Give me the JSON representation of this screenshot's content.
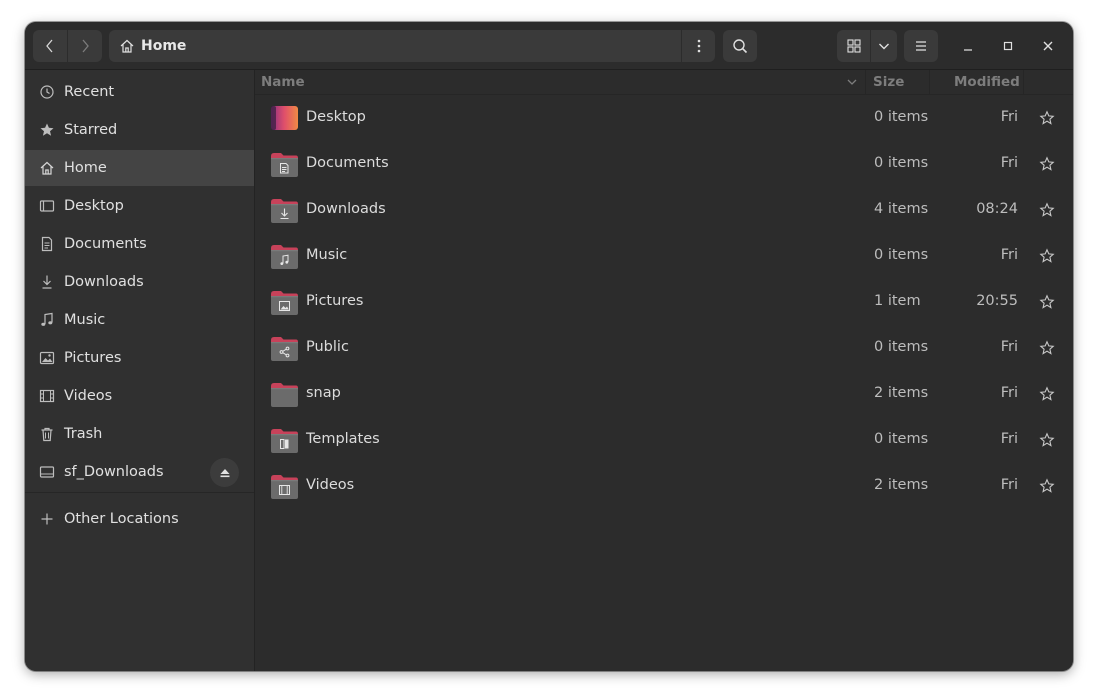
{
  "header": {
    "path_label": "Home",
    "icons": [
      "chevron-left-icon",
      "chevron-right-icon",
      "home-icon",
      "kebab-menu-icon",
      "search-icon",
      "grid-view-icon",
      "chevron-down-icon",
      "hamburger-menu-icon",
      "minimize-icon",
      "maximize-icon",
      "close-icon"
    ]
  },
  "sidebar": {
    "items": [
      {
        "label": "Recent",
        "icon": "clock-icon"
      },
      {
        "label": "Starred",
        "icon": "star-icon"
      },
      {
        "label": "Home",
        "icon": "home-icon",
        "active": true
      },
      {
        "label": "Desktop",
        "icon": "desktop-icon"
      },
      {
        "label": "Documents",
        "icon": "document-icon"
      },
      {
        "label": "Downloads",
        "icon": "download-icon"
      },
      {
        "label": "Music",
        "icon": "music-note-icon"
      },
      {
        "label": "Pictures",
        "icon": "image-icon"
      },
      {
        "label": "Videos",
        "icon": "film-icon"
      },
      {
        "label": "Trash",
        "icon": "trash-icon"
      },
      {
        "label": "sf_Downloads",
        "icon": "drive-icon",
        "eject": true
      }
    ],
    "other_locations": "Other Locations"
  },
  "columns": {
    "name": "Name",
    "size": "Size",
    "modified": "Modified"
  },
  "files": [
    {
      "name": "Desktop",
      "size": "0 items",
      "modified": "Fri",
      "icon": "desktop-folder-icon"
    },
    {
      "name": "Documents",
      "size": "0 items",
      "modified": "Fri",
      "icon": "documents-folder-icon"
    },
    {
      "name": "Downloads",
      "size": "4 items",
      "modified": "08:24",
      "icon": "downloads-folder-icon"
    },
    {
      "name": "Music",
      "size": "0 items",
      "modified": "Fri",
      "icon": "music-folder-icon"
    },
    {
      "name": "Pictures",
      "size": "1 item",
      "modified": "20:55",
      "icon": "pictures-folder-icon"
    },
    {
      "name": "Public",
      "size": "0 items",
      "modified": "Fri",
      "icon": "public-folder-icon"
    },
    {
      "name": "snap",
      "size": "2 items",
      "modified": "Fri",
      "icon": "folder-icon"
    },
    {
      "name": "Templates",
      "size": "0 items",
      "modified": "Fri",
      "icon": "templates-folder-icon"
    },
    {
      "name": "Videos",
      "size": "2 items",
      "modified": "Fri",
      "icon": "videos-folder-icon"
    }
  ],
  "colors": {
    "window_bg": "#2c2c2c",
    "sidebar_bg": "#303030",
    "active_item": "#444444",
    "folder_tab": "#c7425a",
    "folder_body": "#6b6b6b"
  }
}
